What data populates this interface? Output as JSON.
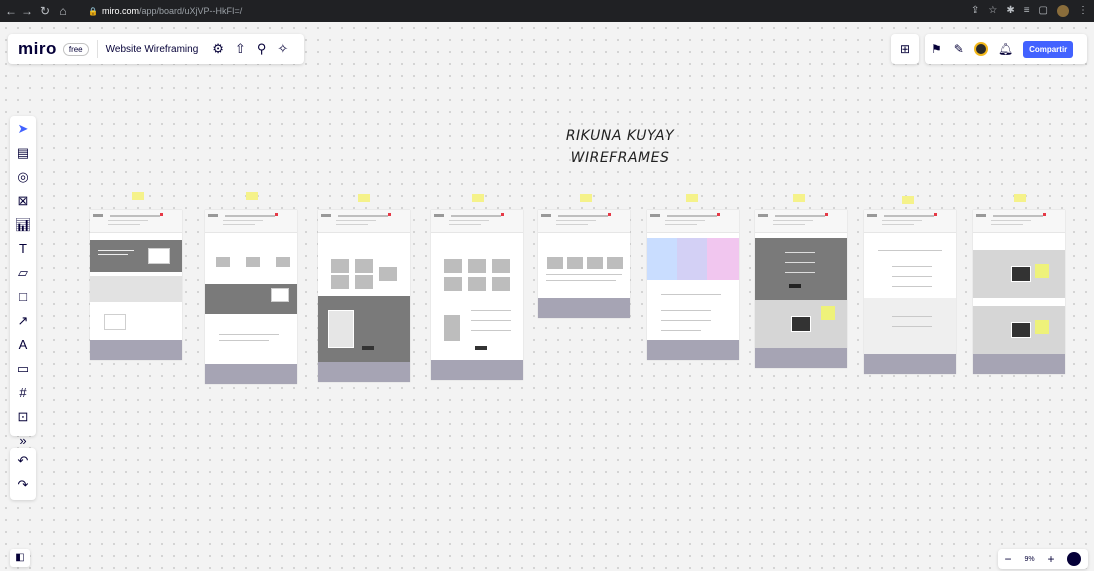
{
  "browser": {
    "url_domain": "miro.com",
    "url_path": "/app/board/uXjVP--HkFI=/"
  },
  "app": {
    "logo": "miro",
    "plan": "free",
    "board_name": "Website Wireframing",
    "share_label": "Compartir"
  },
  "canvas": {
    "title_line1": "RIKUNA KUYAY",
    "title_line2": "WIREFRAMES"
  },
  "zoom": {
    "value": "9%"
  },
  "icons": {
    "settings": "gear-icon",
    "export": "upload-icon",
    "search": "search-icon",
    "magic": "sparkle-icon"
  }
}
